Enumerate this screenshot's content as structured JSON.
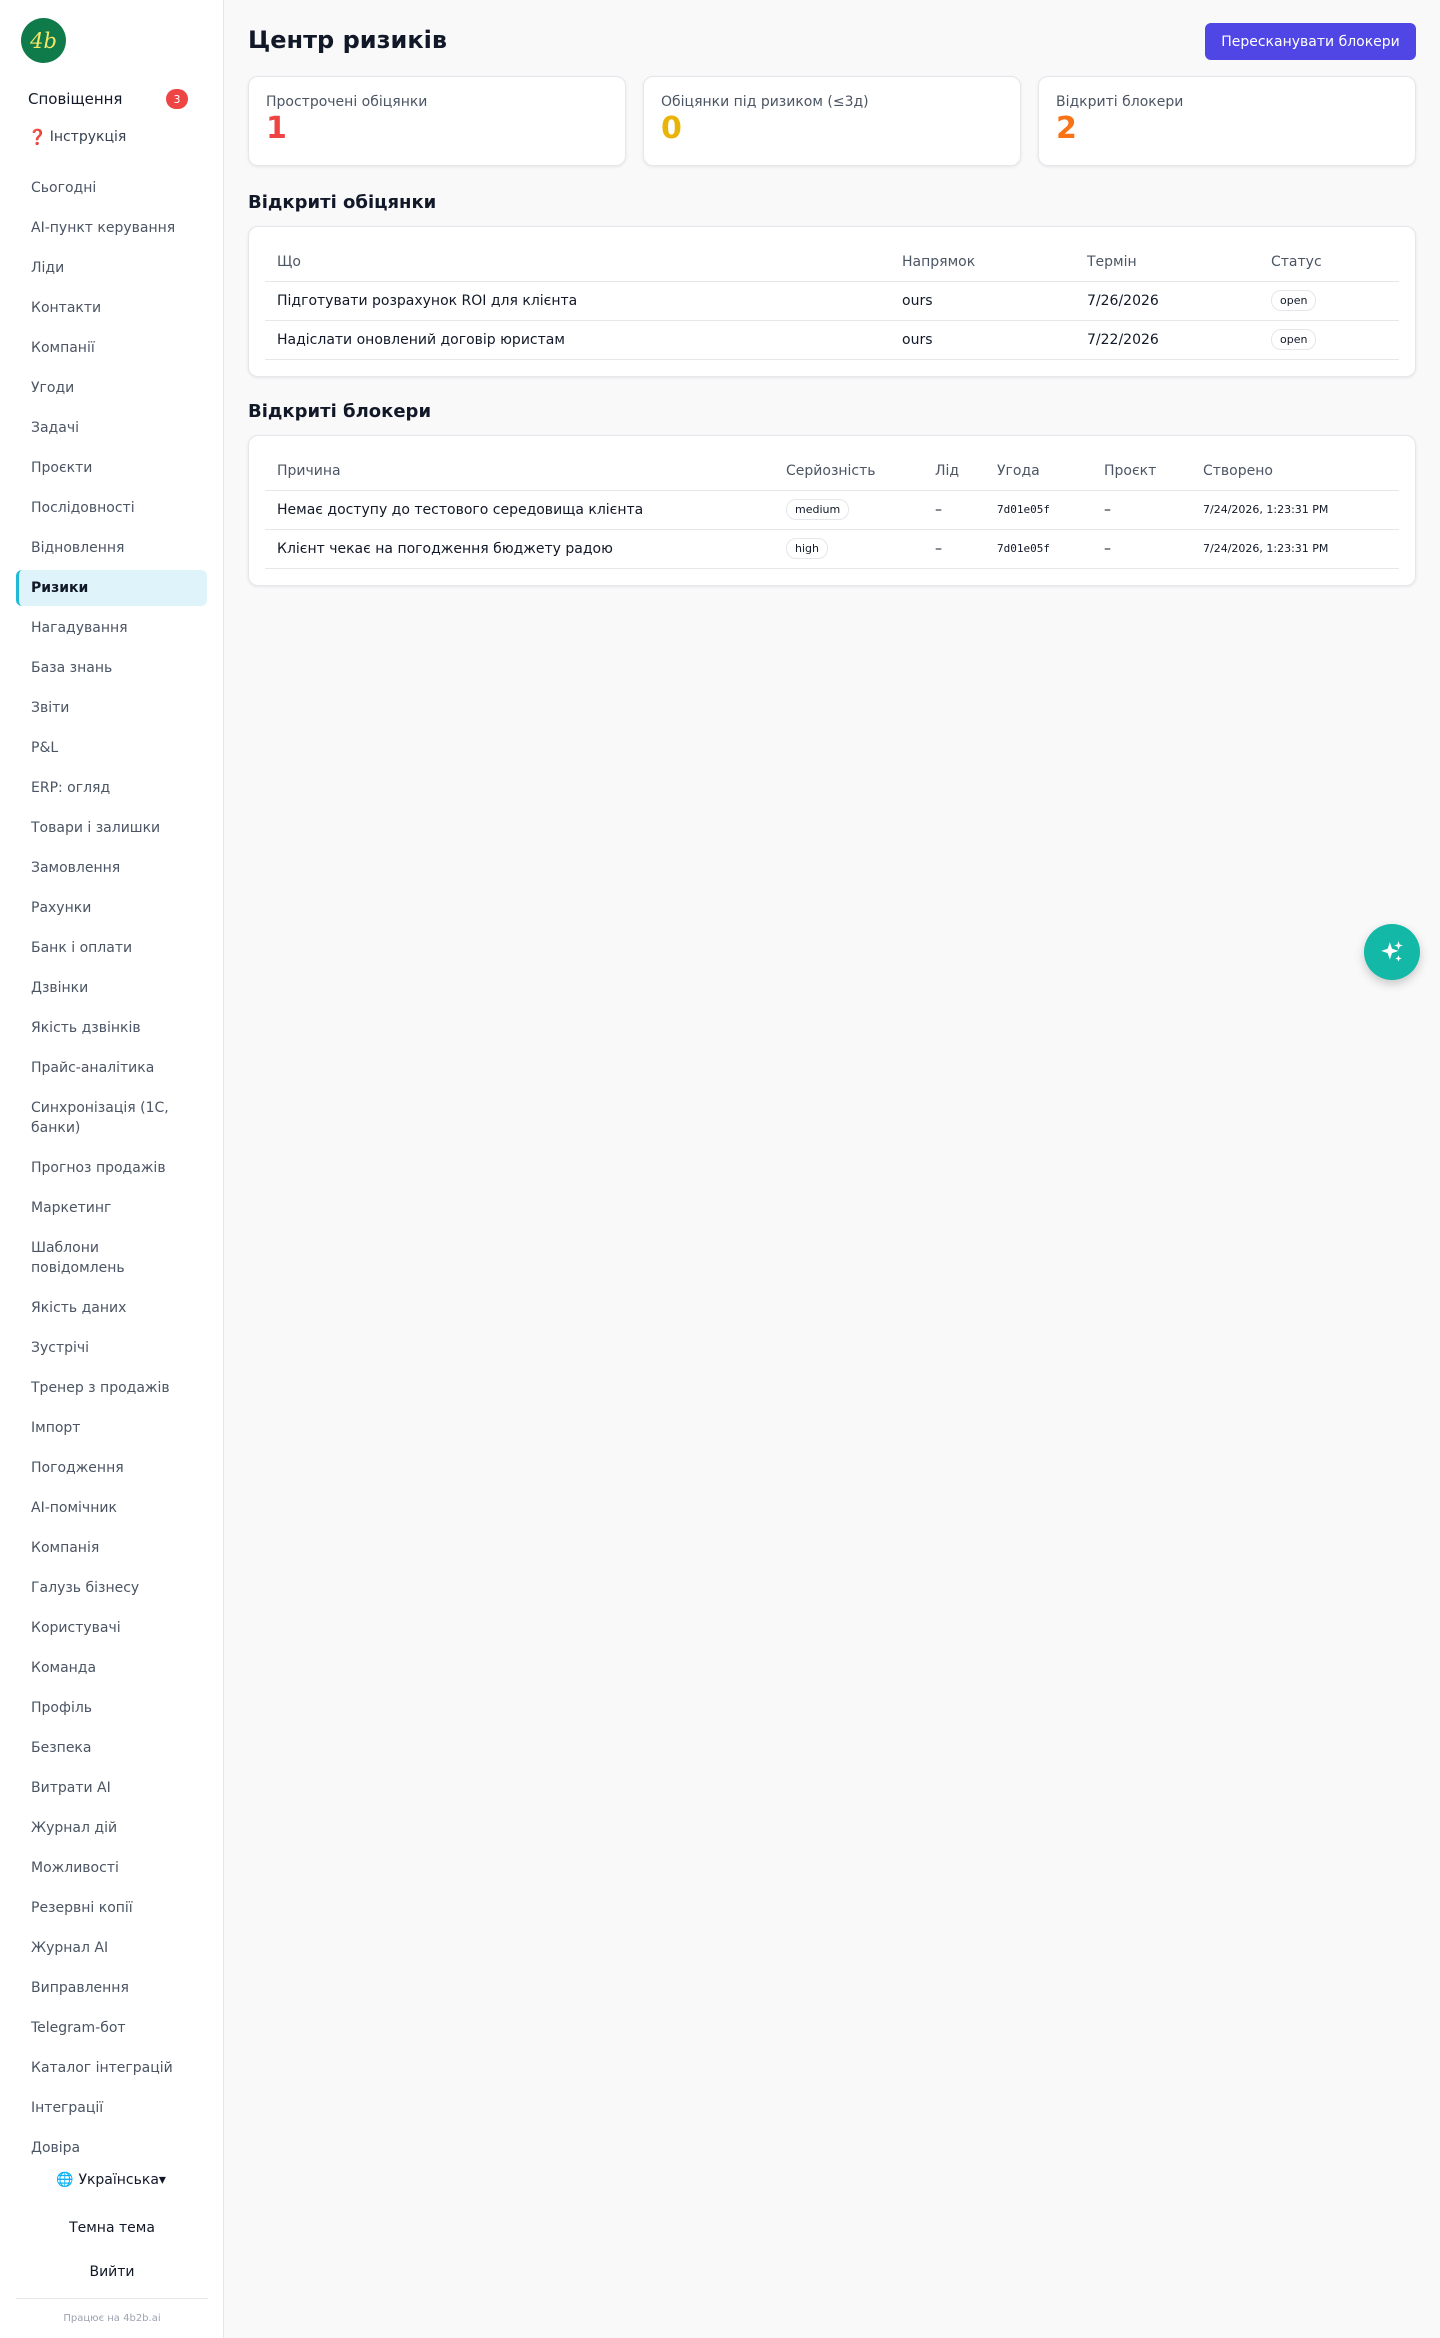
{
  "sidebar": {
    "logo_text": "4b",
    "notifications": {
      "label": "Сповіщення",
      "count": "3"
    },
    "help": {
      "icon": "question-mark-icon",
      "label": "Інструкція"
    },
    "items": [
      {
        "label": "Сьогодні"
      },
      {
        "label": "AI-пункт керування"
      },
      {
        "label": "Ліди"
      },
      {
        "label": "Контакти"
      },
      {
        "label": "Компанії"
      },
      {
        "label": "Угоди"
      },
      {
        "label": "Задачі"
      },
      {
        "label": "Проєкти"
      },
      {
        "label": "Послідовності"
      },
      {
        "label": "Відновлення"
      },
      {
        "label": "Ризики",
        "active": true
      },
      {
        "label": "Нагадування"
      },
      {
        "label": "База знань"
      },
      {
        "label": "Звіти"
      },
      {
        "label": "P&L"
      },
      {
        "label": "ERP: огляд"
      },
      {
        "label": "Товари і залишки"
      },
      {
        "label": "Замовлення"
      },
      {
        "label": "Рахунки"
      },
      {
        "label": "Банк і оплати"
      },
      {
        "label": "Дзвінки"
      },
      {
        "label": "Якість дзвінків"
      },
      {
        "label": "Прайс-аналітика"
      },
      {
        "label": "Синхронізація (1С, банки)"
      },
      {
        "label": "Прогноз продажів"
      },
      {
        "label": "Маркетинг"
      },
      {
        "label": "Шаблони повідомлень"
      },
      {
        "label": "Якість даних"
      },
      {
        "label": "Зустрічі"
      },
      {
        "label": "Тренер з продажів"
      },
      {
        "label": "Імпорт"
      },
      {
        "label": "Погодження"
      },
      {
        "label": "AI-помічник"
      },
      {
        "label": "Компанія"
      },
      {
        "label": "Галузь бізнесу"
      },
      {
        "label": "Користувачі"
      },
      {
        "label": "Команда"
      },
      {
        "label": "Профіль"
      },
      {
        "label": "Безпека"
      },
      {
        "label": "Витрати AI"
      },
      {
        "label": "Журнал дій"
      },
      {
        "label": "Можливості"
      },
      {
        "label": "Резервні копії"
      },
      {
        "label": "Журнал AI"
      },
      {
        "label": "Виправлення"
      },
      {
        "label": "Telegram-бот"
      },
      {
        "label": "Каталог інтеграцій"
      },
      {
        "label": "Інтеграції"
      },
      {
        "label": "Довіра"
      }
    ],
    "language": {
      "icon": "globe-icon",
      "label": "Українська",
      "caret": "▾"
    },
    "theme_label": "Темна тема",
    "logout_label": "Вийти",
    "powered_by": "Працює на 4b2b.ai"
  },
  "page": {
    "title": "Центр ризиків",
    "rescan_label": "Пересканувати блокери"
  },
  "kpis": [
    {
      "label": "Прострочені обіцянки",
      "value": "1",
      "color": "#ef4444"
    },
    {
      "label": "Обіцянки під ризиком (≤3д)",
      "value": "0",
      "color": "#eab308"
    },
    {
      "label": "Відкриті блокери",
      "value": "2",
      "color": "#f97316"
    }
  ],
  "promises": {
    "title": "Відкриті обіцянки",
    "columns": [
      "Що",
      "Напрямок",
      "Термін",
      "Статус"
    ],
    "rows": [
      {
        "what": "Підготувати розрахунок ROI для клієнта",
        "direction": "ours",
        "due": "7/26/2026",
        "status": "open"
      },
      {
        "what": "Надіслати оновлений договір юристам",
        "direction": "ours",
        "due": "7/22/2026",
        "status": "open"
      }
    ]
  },
  "blockers": {
    "title": "Відкриті блокери",
    "columns": [
      "Причина",
      "Серйозність",
      "Лід",
      "Угода",
      "Проєкт",
      "Створено"
    ],
    "rows": [
      {
        "reason": "Немає доступу до тестового середовища клієнта",
        "severity": "medium",
        "lead": "–",
        "deal": "7d01e05f",
        "project": "–",
        "created": "7/24/2026, 1:23:31 PM"
      },
      {
        "reason": "Клієнт чекає на погодження бюджету радою",
        "severity": "high",
        "lead": "–",
        "deal": "7d01e05f",
        "project": "–",
        "created": "7/24/2026, 1:23:31 PM"
      }
    ]
  },
  "fab": {
    "icon": "sparkles-icon",
    "color": "#14b8a6"
  }
}
